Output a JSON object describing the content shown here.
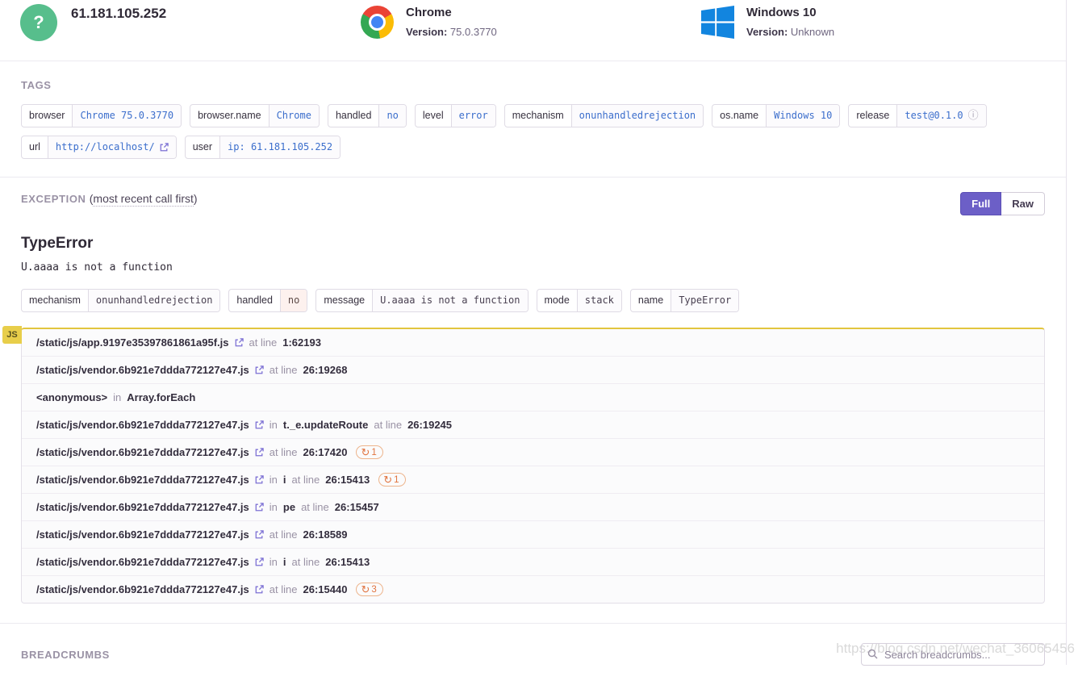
{
  "header": {
    "avatar_glyph": "?",
    "title": "61.181.105.252",
    "browser": {
      "name": "Chrome",
      "version_label": "Version:",
      "version": "75.0.3770",
      "icon": "chrome-logo"
    },
    "os": {
      "name": "Windows 10",
      "version_label": "Version:",
      "version": "Unknown",
      "icon": "windows-logo"
    }
  },
  "tags": {
    "section_title": "TAGS",
    "rows": [
      [
        {
          "key": "browser",
          "value": "Chrome 75.0.3770"
        },
        {
          "key": "browser.name",
          "value": "Chrome"
        },
        {
          "key": "handled",
          "value": "no"
        },
        {
          "key": "level",
          "value": "error"
        },
        {
          "key": "mechanism",
          "value": "onunhandledrejection"
        },
        {
          "key": "os.name",
          "value": "Windows 10"
        },
        {
          "key": "release",
          "value": "test@0.1.0",
          "icon": "info"
        }
      ],
      [
        {
          "key": "url",
          "value": "http://localhost/",
          "icon": "external-link"
        },
        {
          "key": "user",
          "value": "ip: 61.181.105.252"
        }
      ]
    ]
  },
  "exception": {
    "section_title": "EXCEPTION",
    "subtitle_open": "(",
    "subtitle": "most recent call first",
    "subtitle_close": ")",
    "view_toggle": {
      "full": "Full",
      "raw": "Raw",
      "active": "Full"
    },
    "error_type": "TypeError",
    "error_message": "U.aaaa is not a function",
    "meta": [
      {
        "key": "mechanism",
        "value": "onunhandledrejection"
      },
      {
        "key": "handled",
        "value": "no",
        "highlight": "red"
      },
      {
        "key": "message",
        "value": "U.aaaa is not a function"
      },
      {
        "key": "mode",
        "value": "stack"
      },
      {
        "key": "name",
        "value": "TypeError"
      }
    ],
    "platform_badge": "JS",
    "labels": {
      "in": "in",
      "at_line": "at line"
    },
    "frames": [
      {
        "path": "/static/js/app.9197e35397861861a95f.js",
        "link": true,
        "at_line": "1:62193"
      },
      {
        "path": "/static/js/vendor.6b921e7ddda772127e47.js",
        "link": true,
        "at_line": "26:19268"
      },
      {
        "path": "<anonymous>",
        "link": false,
        "fn": "Array.forEach"
      },
      {
        "path": "/static/js/vendor.6b921e7ddda772127e47.js",
        "link": true,
        "fn": "t._e.updateRoute",
        "at_line": "26:19245"
      },
      {
        "path": "/static/js/vendor.6b921e7ddda772127e47.js",
        "link": true,
        "at_line": "26:17420",
        "repeats": "1"
      },
      {
        "path": "/static/js/vendor.6b921e7ddda772127e47.js",
        "link": true,
        "fn": "i",
        "at_line": "26:15413",
        "repeats": "1"
      },
      {
        "path": "/static/js/vendor.6b921e7ddda772127e47.js",
        "link": true,
        "fn": "pe",
        "at_line": "26:15457"
      },
      {
        "path": "/static/js/vendor.6b921e7ddda772127e47.js",
        "link": true,
        "at_line": "26:18589"
      },
      {
        "path": "/static/js/vendor.6b921e7ddda772127e47.js",
        "link": true,
        "fn": "i",
        "at_line": "26:15413"
      },
      {
        "path": "/static/js/vendor.6b921e7ddda772127e47.js",
        "link": true,
        "at_line": "26:15440",
        "repeats": "3"
      }
    ]
  },
  "breadcrumbs": {
    "section_title": "BREADCRUMBS",
    "search_placeholder": "Search breadcrumbs...",
    "search_icon": "magnifier",
    "watermark": "https://blog.csdn.net/wechat_36065456"
  },
  "colors": {
    "accent_purple": "#6c5fc7",
    "tag_value_blue": "#3b6ecc",
    "platform_badge_yellow": "#e8ce4a",
    "repeat_orange": "#e1743f",
    "avatar_green": "#57be8c",
    "windows_blue": "#1285df"
  }
}
